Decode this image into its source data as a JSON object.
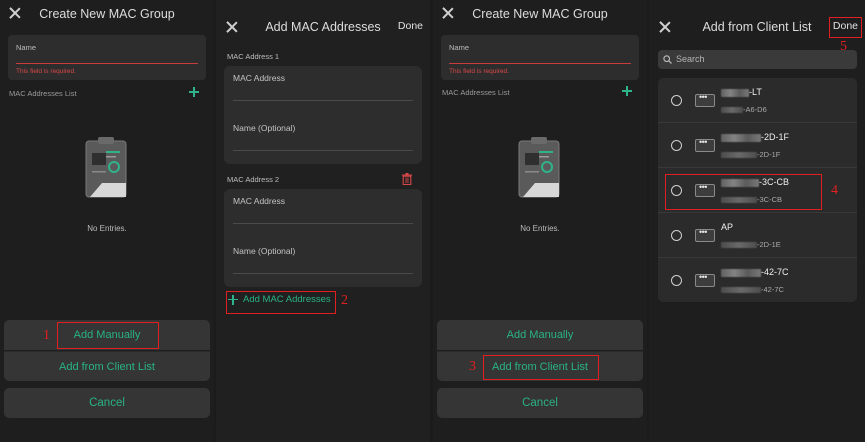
{
  "screen1": {
    "title": "Create New MAC Group",
    "name_label": "Name",
    "name_error": "This field is required.",
    "list_label": "MAC Addresses List",
    "empty_text": "No Entries.",
    "add_manually": "Add Manually",
    "add_from_client": "Add from Client List",
    "cancel": "Cancel",
    "annotation": "1"
  },
  "screen2": {
    "title": "Add MAC Addresses",
    "done": "Done",
    "section1": "MAC Address 1",
    "section2": "MAC Address 2",
    "mac_placeholder": "MAC Address",
    "name_placeholder": "Name (Optional)",
    "add_more": "Add MAC Addresses",
    "annotation": "2"
  },
  "screen3": {
    "title": "Create New MAC Group",
    "name_label": "Name",
    "name_error": "This field is required.",
    "list_label": "MAC Addresses List",
    "empty_text": "No Entries.",
    "add_manually": "Add Manually",
    "add_from_client": "Add from Client List",
    "cancel": "Cancel",
    "annotation": "3"
  },
  "screen4": {
    "title": "Add from Client List",
    "done": "Done",
    "search_placeholder": "Search",
    "annotation_selected": "4",
    "annotation_done": "5",
    "clients": [
      {
        "name": "-LT",
        "mac": "-A6-D6"
      },
      {
        "name": "-2D-1F",
        "mac": "-2D-1F"
      },
      {
        "name": "-3C-CB",
        "mac": "-3C-CB"
      },
      {
        "name": "AP",
        "mac": "-2D-1E"
      },
      {
        "name": "-42-7C",
        "mac": "-42-7C"
      }
    ]
  },
  "colors": {
    "accent": "#29b386",
    "error": "#d84848",
    "annotation": "#e02020",
    "background": "#1e1e1e"
  }
}
